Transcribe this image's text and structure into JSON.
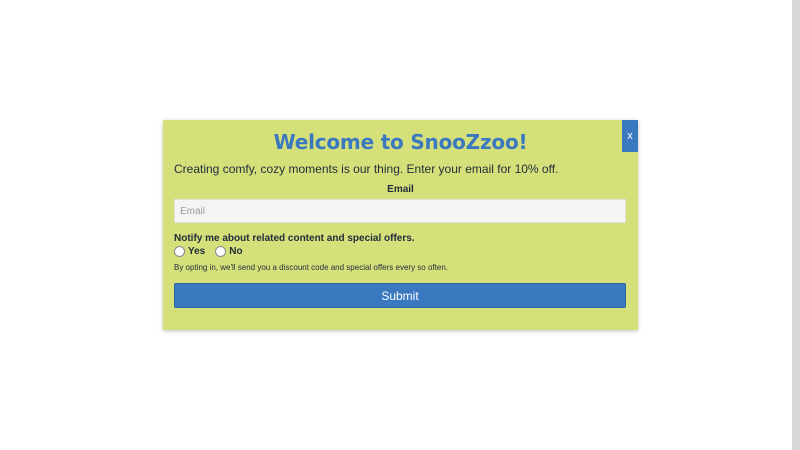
{
  "popup": {
    "close_label": "x",
    "title": "Welcome to SnooZzoo!",
    "intro": "Creating comfy, cozy moments is our thing. Enter your email for 10% off.",
    "email_label": "Email",
    "email_placeholder": "Email",
    "email_value": "",
    "notify_label": "Notify me about related content and special offers.",
    "options": [
      {
        "label": "Yes",
        "selected": false
      },
      {
        "label": "No",
        "selected": false
      }
    ],
    "disclaimer": "By opting in, we'll send you a discount code and special offers every so often.",
    "submit_label": "Submit"
  },
  "colors": {
    "popup_background": "#d6e07a",
    "accent": "#3a78bf",
    "text": "#1f2b3a",
    "page_background": "#ffffff"
  }
}
